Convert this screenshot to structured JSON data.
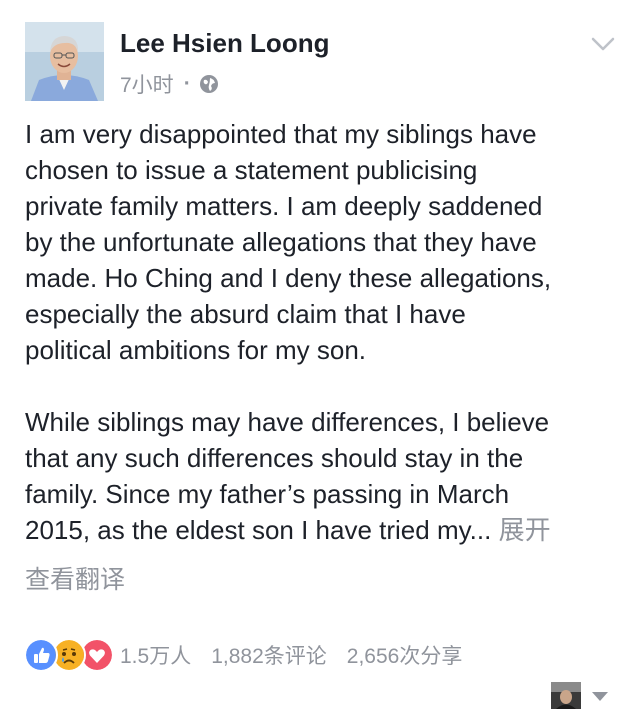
{
  "post": {
    "author": "Lee Hsien Loong",
    "timestamp": "7小时",
    "separator": "·",
    "audience_icon": "globe-icon",
    "options_icon": "chevron-down-icon",
    "paragraph1_lines": [
      "I am very disappointed that my siblings have",
      "chosen to issue a statement publicising",
      "private family matters. I am deeply saddened",
      "by the unfortunate allegations that they have",
      "made. Ho Ching and I deny these allegations,",
      "especially the absurd claim that I have",
      "political ambitions for my son."
    ],
    "paragraph2_lines": [
      "While siblings may have differences, I believe",
      "that any such differences should stay in the",
      "family. Since my father’s passing in March",
      "2015, as the eldest son I have tried my..."
    ],
    "see_more": "展开",
    "translate": "查看翻译"
  },
  "reactions": {
    "icons": [
      "like-icon",
      "sad-icon",
      "love-icon"
    ],
    "colors": {
      "like": "#5890ff",
      "sad": "#f7b125",
      "love": "#f25268"
    },
    "count": "1.5万人",
    "comments": "1,882条评论",
    "shares": "2,656次分享"
  },
  "footer": {
    "avatar_icon": "profile-avatar",
    "caret_icon": "caret-down-icon"
  }
}
